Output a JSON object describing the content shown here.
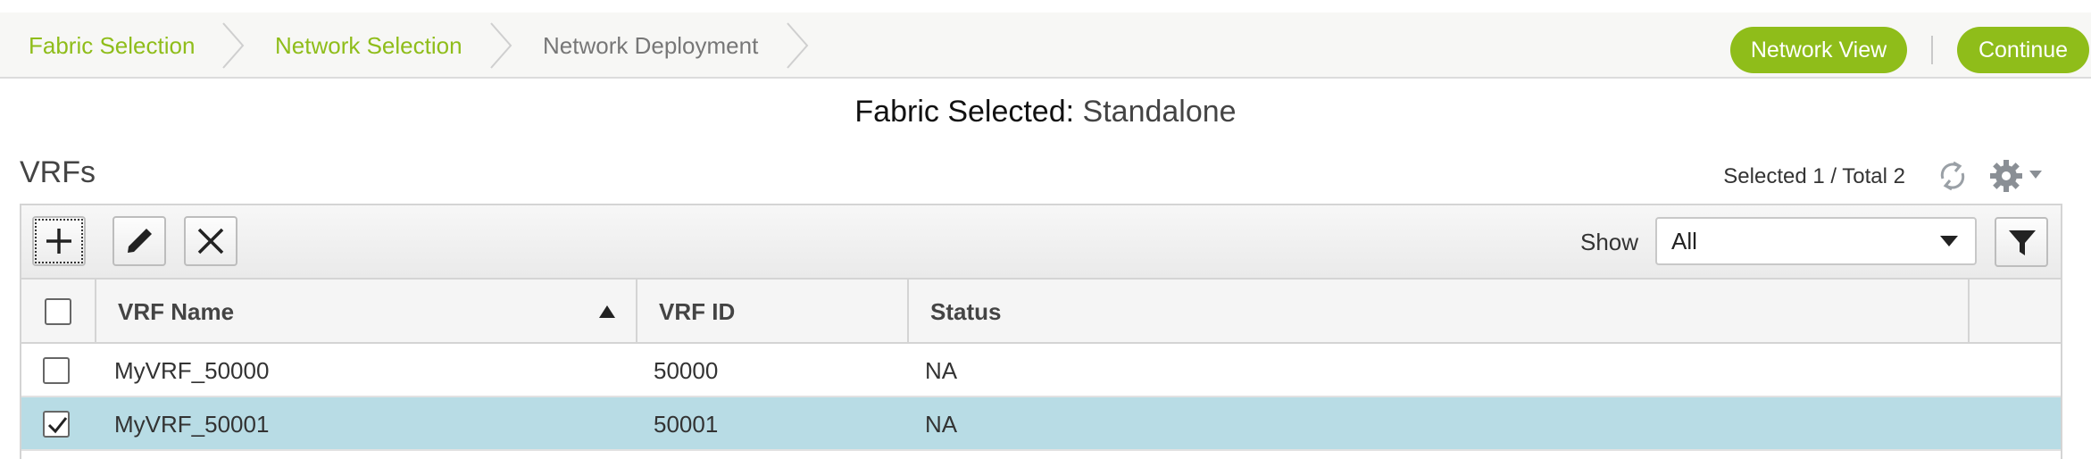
{
  "wizard": {
    "steps": [
      {
        "label": "Fabric Selection",
        "state": "done"
      },
      {
        "label": "Network Selection",
        "state": "done"
      },
      {
        "label": "Network Deployment",
        "state": "current"
      }
    ],
    "network_view_label": "Network View",
    "continue_label": "Continue"
  },
  "fabric": {
    "prefix": "Fabric Selected:",
    "value": "Standalone"
  },
  "vrfs": {
    "title": "VRFs",
    "selection_summary": "Selected 1 / Total 2",
    "icons": {
      "refresh": "refresh-icon",
      "settings": "gear-icon"
    }
  },
  "toolbar": {
    "add_icon": "plus-icon",
    "edit_icon": "pencil-icon",
    "delete_icon": "x-icon",
    "show_label": "Show",
    "show_value": "All",
    "filter_icon": "funnel-icon"
  },
  "table": {
    "columns": [
      "VRF Name",
      "VRF ID",
      "Status"
    ],
    "sort": {
      "column": "VRF Name",
      "direction": "ascending"
    },
    "rows": [
      {
        "name": "MyVRF_50000",
        "id": "50000",
        "status": "NA",
        "checked": false
      },
      {
        "name": "MyVRF_50001",
        "id": "50001",
        "status": "NA",
        "checked": true
      }
    ]
  },
  "colors": {
    "accent": "#8fbd1a",
    "selected_row": "#b8dce5"
  }
}
